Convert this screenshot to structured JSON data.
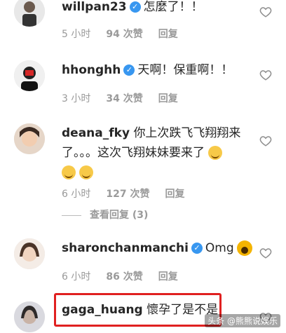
{
  "comments": [
    {
      "username": "willpan23",
      "text": "怎麼了！！",
      "time": "5 小时",
      "likes": "94 次赞",
      "reply": "回复"
    },
    {
      "username": "hhonghh",
      "text": "天啊！保重啊！！",
      "time": "3 小时",
      "likes": "34 次赞",
      "reply": "回复"
    },
    {
      "username": "deana_fky",
      "text_line1": "你上次跌飞飞翔翔来",
      "text_line2": "了。。。这次飞翔妹妹要来了",
      "time": "6 小时",
      "likes": "127 次赞",
      "reply": "回复",
      "view_replies": "查看回复 (3)"
    },
    {
      "username": "sharonchanmanchi",
      "text": "Omg",
      "time": "6 小时",
      "likes": "86 次赞",
      "reply": "回复"
    },
    {
      "username": "gaga_huang",
      "text": "懷孕了是不是"
    }
  ],
  "watermark": "头条 @熊熊说娱乐",
  "colors": {
    "verified": "#3897f0",
    "highlight_border": "#e02020",
    "meta": "#9a9a9a"
  }
}
